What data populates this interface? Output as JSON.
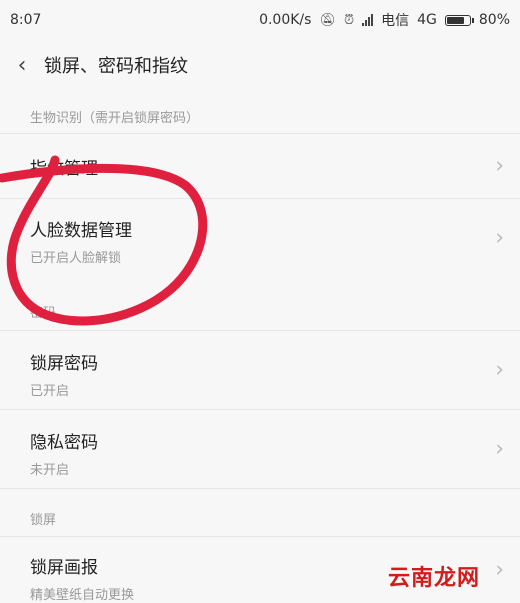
{
  "status_bar": {
    "time": "8:07",
    "speed": "0.00K/s",
    "carrier": "电信",
    "network": "4G",
    "battery": "80%",
    "battery_level": 0.8
  },
  "header": {
    "title": "锁屏、密码和指纹"
  },
  "sections": {
    "biometrics_label": "生物识别（需开启锁屏密码）",
    "password_label": "密码",
    "lockscreen_label": "锁屏"
  },
  "items": {
    "fingerprint": {
      "title": "指纹管理"
    },
    "face": {
      "title": "人脸数据管理",
      "subtitle": "已开启人脸解锁"
    },
    "lock_password": {
      "title": "锁屏密码",
      "subtitle": "已开启"
    },
    "privacy_password": {
      "title": "隐私密码",
      "subtitle": "未开启"
    },
    "lock_art": {
      "title": "锁屏画报",
      "subtitle": "精美壁纸自动更换"
    }
  },
  "watermark": "云南龙网",
  "colors": {
    "annotation": "#e0203f",
    "watermark": "#d21c1c"
  }
}
